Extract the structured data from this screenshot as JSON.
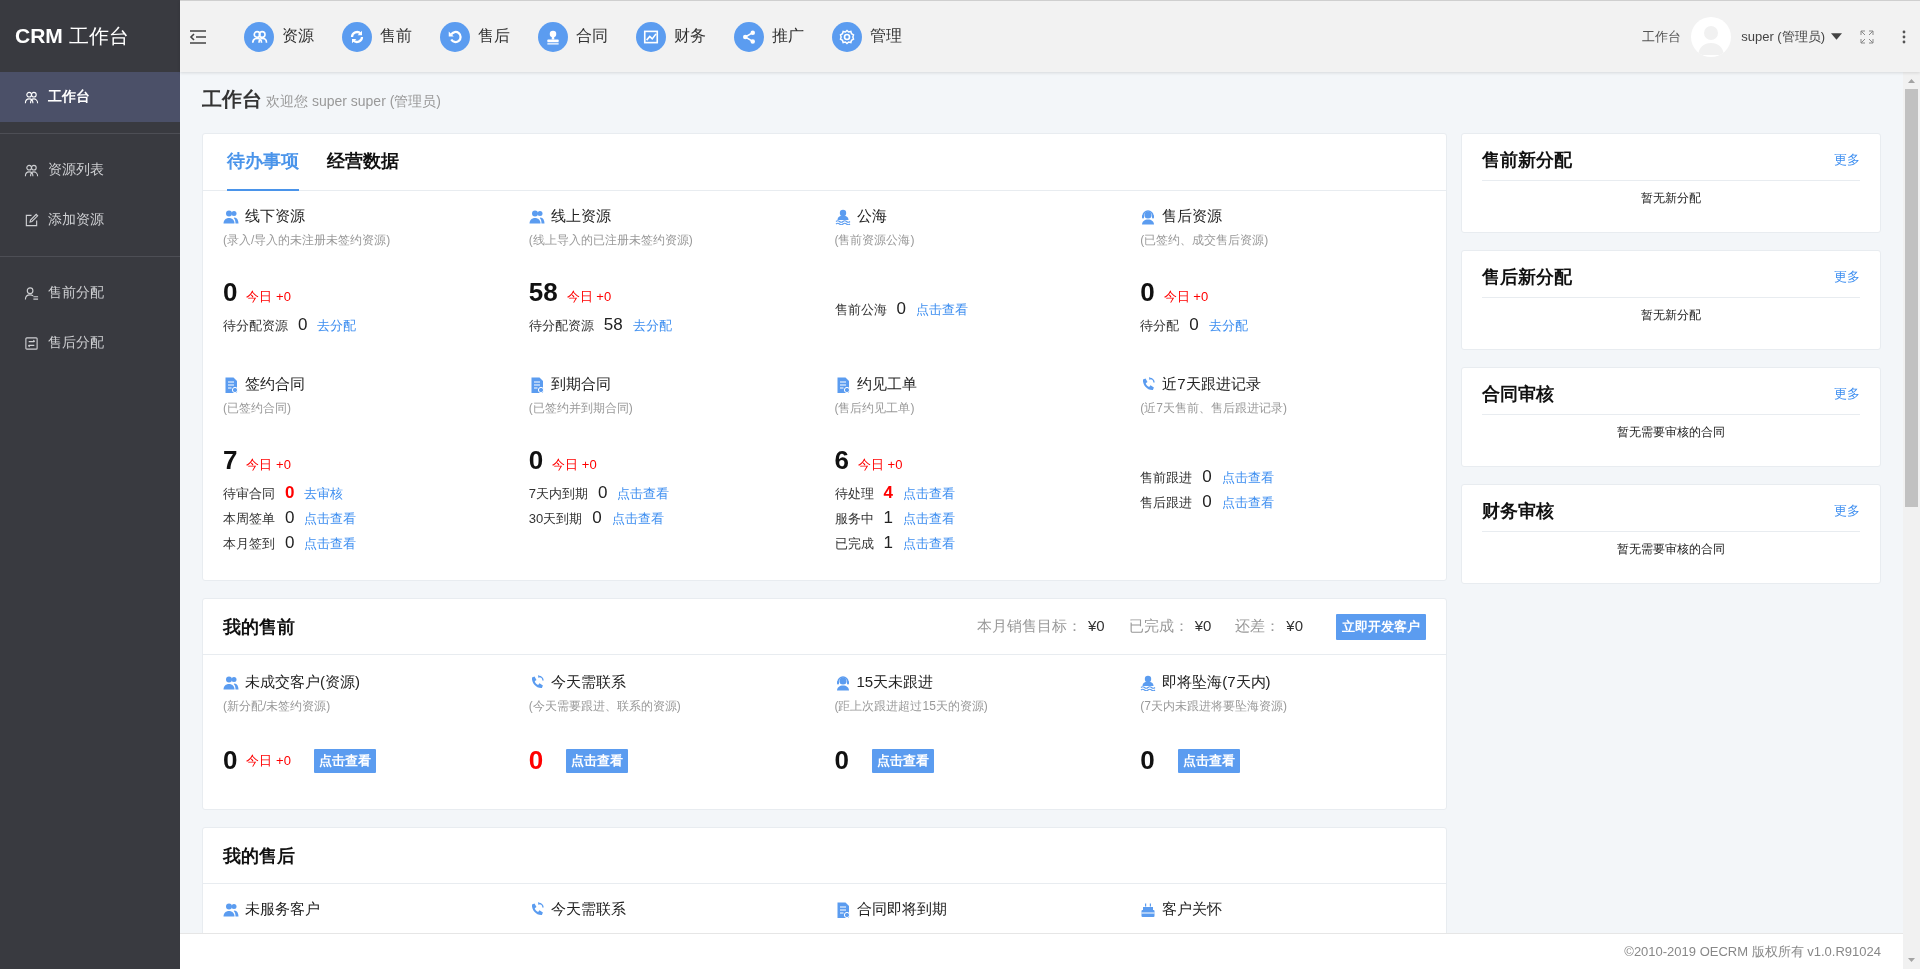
{
  "sidebar": {
    "brand": "CRM",
    "title": "工作台",
    "groups": [
      {
        "items": [
          {
            "label": "工作台",
            "kind": "people",
            "selected": true
          }
        ]
      },
      {
        "items": [
          {
            "label": "资源列表",
            "kind": "people",
            "selected": false
          },
          {
            "label": "添加资源",
            "kind": "edit",
            "selected": false
          }
        ]
      },
      {
        "items": [
          {
            "label": "售前分配",
            "kind": "user-list",
            "selected": false
          },
          {
            "label": "售后分配",
            "kind": "list",
            "selected": false
          }
        ]
      }
    ]
  },
  "topbar": {
    "nav": [
      {
        "label": "资源",
        "kind": "people"
      },
      {
        "label": "售前",
        "kind": "refresh"
      },
      {
        "label": "售后",
        "kind": "undo"
      },
      {
        "label": "合同",
        "kind": "stamp"
      },
      {
        "label": "财务",
        "kind": "chart"
      },
      {
        "label": "推广",
        "kind": "share"
      },
      {
        "label": "管理",
        "kind": "gear"
      }
    ],
    "breadcrumb": "工作台",
    "user": "super (管理员)"
  },
  "page": {
    "title": "工作台",
    "welcome": "欢迎您 super super (管理员)"
  },
  "todo": {
    "tabs": [
      {
        "label": "待办事项",
        "selected": true
      },
      {
        "label": "经营数据",
        "selected": false
      }
    ],
    "items": [
      {
        "title": "线下资源",
        "subtitle": "(录入/导入的未注册未签约资源)",
        "kind": "people",
        "count": "0",
        "today": "今日 +0",
        "lines": [
          {
            "label": "待分配资源",
            "value": "0",
            "alert": false,
            "link": "去分配"
          }
        ]
      },
      {
        "title": "线上资源",
        "subtitle": "(线上导入的已注册未签约资源)",
        "kind": "people",
        "count": "58",
        "today": "今日 +0",
        "lines": [
          {
            "label": "待分配资源",
            "value": "58",
            "alert": false,
            "link": "去分配"
          }
        ]
      },
      {
        "title": "公海",
        "subtitle": "(售前资源公海)",
        "kind": "sea",
        "lines": [
          {
            "label": "售前公海",
            "value": "0",
            "alert": false,
            "link": "点击查看"
          }
        ]
      },
      {
        "title": "售后资源",
        "subtitle": "(已签约、成交售后资源)",
        "kind": "headset",
        "count": "0",
        "today": "今日 +0",
        "lines": [
          {
            "label": "待分配",
            "value": "0",
            "alert": false,
            "link": "去分配"
          }
        ]
      },
      {
        "title": "签约合同",
        "subtitle": "(已签约合同)",
        "kind": "doc",
        "count": "7",
        "today": "今日 +0",
        "lines": [
          {
            "label": "待审合同",
            "value": "0",
            "alert": true,
            "link": "去审核"
          },
          {
            "label": "本周签单",
            "value": "0",
            "alert": false,
            "link": "点击查看"
          },
          {
            "label": "本月签到",
            "value": "0",
            "alert": false,
            "link": "点击查看"
          }
        ]
      },
      {
        "title": "到期合同",
        "subtitle": "(已签约并到期合同)",
        "kind": "doc",
        "count": "0",
        "today": "今日 +0",
        "lines": [
          {
            "label": "7天内到期",
            "value": "0",
            "alert": false,
            "link": "点击查看"
          },
          {
            "label": "30天到期",
            "value": "0",
            "alert": false,
            "link": "点击查看"
          }
        ]
      },
      {
        "title": "约见工单",
        "subtitle": "(售后约见工单)",
        "kind": "doc",
        "count": "6",
        "today": "今日 +0",
        "lines": [
          {
            "label": "待处理",
            "value": "4",
            "alert": true,
            "link": "点击查看"
          },
          {
            "label": "服务中",
            "value": "1",
            "alert": false,
            "link": "点击查看"
          },
          {
            "label": "已完成",
            "value": "1",
            "alert": false,
            "link": "点击查看"
          }
        ]
      },
      {
        "title": "近7天跟进记录",
        "subtitle": "(近7天售前、售后跟进记录)",
        "kind": "phone",
        "lines": [
          {
            "label": "售前跟进",
            "value": "0",
            "alert": false,
            "link": "点击查看"
          },
          {
            "label": "售后跟进",
            "value": "0",
            "alert": false,
            "link": "点击查看"
          }
        ]
      }
    ]
  },
  "presale": {
    "title": "我的售前",
    "stats": [
      {
        "label": "本月销售目标：",
        "value": "¥0"
      },
      {
        "label": "已完成：",
        "value": "¥0"
      },
      {
        "label": "还差：",
        "value": "¥0"
      }
    ],
    "action": "立即开发客户",
    "items": [
      {
        "title": "未成交客户(资源)",
        "subtitle": "(新分配/未签约资源)",
        "kind": "people",
        "count": "0",
        "alert": false,
        "today": "今日 +0",
        "button": "点击查看"
      },
      {
        "title": "今天需联系",
        "subtitle": "(今天需要跟进、联系的资源)",
        "kind": "phone",
        "count": "0",
        "alert": true,
        "button": "点击查看"
      },
      {
        "title": "15天未跟进",
        "subtitle": "(距上次跟进超过15天的资源)",
        "kind": "headset",
        "count": "0",
        "alert": false,
        "button": "点击查看"
      },
      {
        "title": "即将坠海(7天内)",
        "subtitle": "(7天内未跟进将要坠海资源)",
        "kind": "sea",
        "count": "0",
        "alert": false,
        "button": "点击查看"
      }
    ]
  },
  "aftersale": {
    "title": "我的售后",
    "items": [
      {
        "title": "未服务客户",
        "kind": "people"
      },
      {
        "title": "今天需联系",
        "kind": "phone"
      },
      {
        "title": "合同即将到期",
        "kind": "doc"
      },
      {
        "title": "客户关怀",
        "kind": "cake"
      }
    ]
  },
  "side_cards": [
    {
      "title": "售前新分配",
      "more": "更多",
      "empty": "暂无新分配"
    },
    {
      "title": "售后新分配",
      "more": "更多",
      "empty": "暂无新分配"
    },
    {
      "title": "合同审核",
      "more": "更多",
      "empty": "暂无需要审核的合同"
    },
    {
      "title": "财务审核",
      "more": "更多",
      "empty": "暂无需要审核的合同"
    }
  ],
  "footer": "©2010-2019 OECRM 版权所有 v1.0.R91024"
}
